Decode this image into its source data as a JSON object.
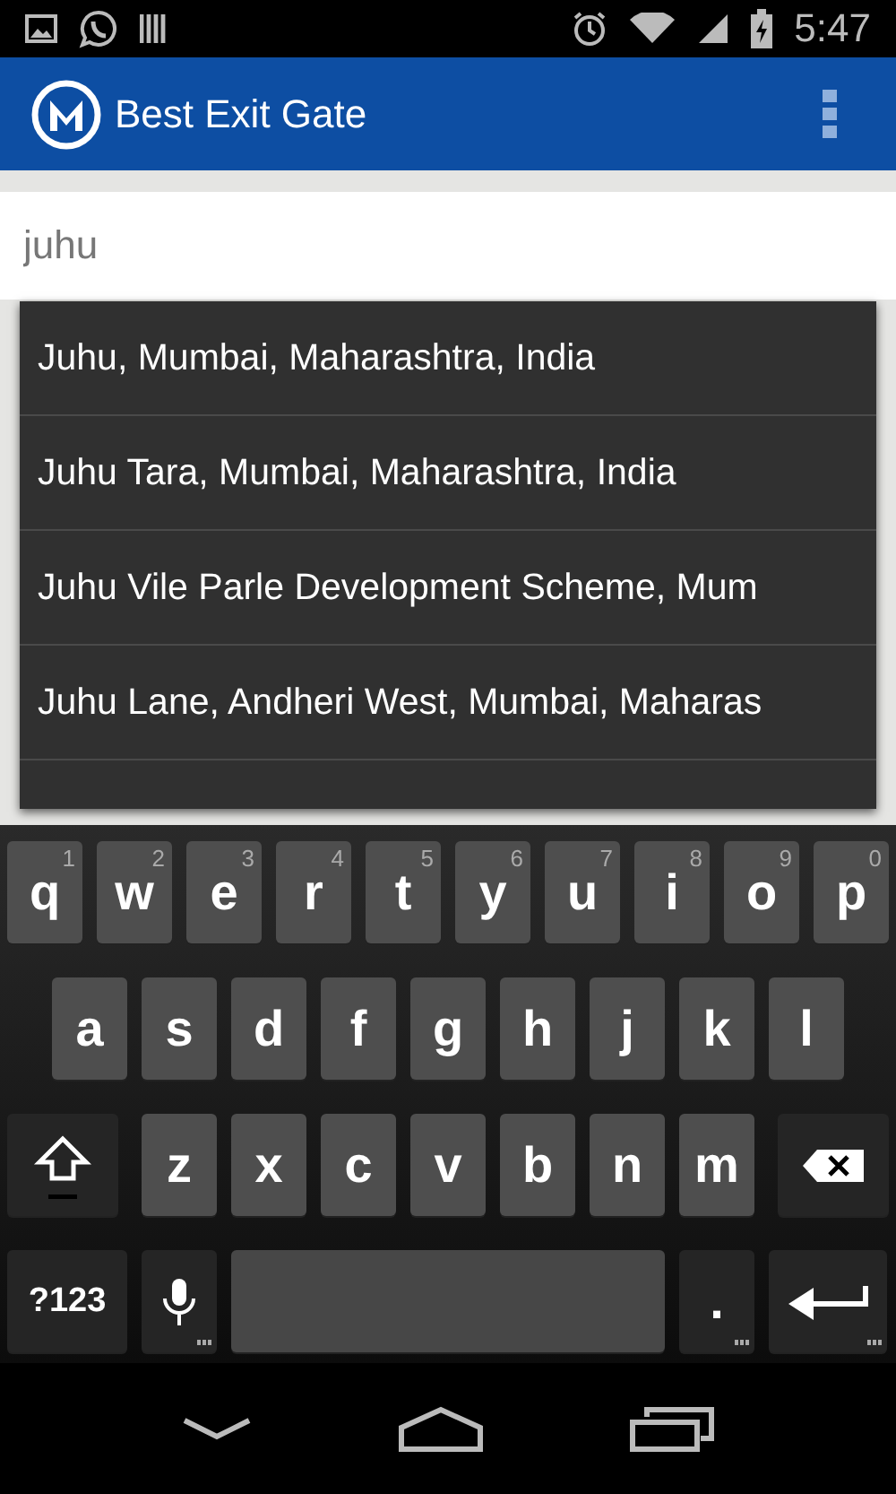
{
  "status_bar": {
    "time": "5:47"
  },
  "app_bar": {
    "title": "Best Exit Gate"
  },
  "search": {
    "value": "juhu"
  },
  "suggestions": [
    {
      "text": "Juhu, Mumbai, Maharashtra, India"
    },
    {
      "text": "Juhu Tara, Mumbai, Maharashtra, India"
    },
    {
      "text": "Juhu Vile Parle Development Scheme, Mum"
    },
    {
      "text": "Juhu Lane, Andheri West, Mumbai, Maharas"
    }
  ],
  "keyboard": {
    "rows": [
      {
        "keys": [
          {
            "kind": "letter",
            "label": "q",
            "hint": "1"
          },
          {
            "kind": "letter",
            "label": "w",
            "hint": "2"
          },
          {
            "kind": "letter",
            "label": "e",
            "hint": "3"
          },
          {
            "kind": "letter",
            "label": "r",
            "hint": "4"
          },
          {
            "kind": "letter",
            "label": "t",
            "hint": "5"
          },
          {
            "kind": "letter",
            "label": "y",
            "hint": "6"
          },
          {
            "kind": "letter",
            "label": "u",
            "hint": "7"
          },
          {
            "kind": "letter",
            "label": "i",
            "hint": "8"
          },
          {
            "kind": "letter",
            "label": "o",
            "hint": "9"
          },
          {
            "kind": "letter",
            "label": "p",
            "hint": "0"
          }
        ]
      },
      {
        "keys": [
          {
            "kind": "letter",
            "label": "a"
          },
          {
            "kind": "letter",
            "label": "s"
          },
          {
            "kind": "letter",
            "label": "d"
          },
          {
            "kind": "letter",
            "label": "f"
          },
          {
            "kind": "letter",
            "label": "g"
          },
          {
            "kind": "letter",
            "label": "h"
          },
          {
            "kind": "letter",
            "label": "j"
          },
          {
            "kind": "letter",
            "label": "k"
          },
          {
            "kind": "letter",
            "label": "l"
          }
        ]
      },
      {
        "keys": [
          {
            "kind": "shift"
          },
          {
            "kind": "letter",
            "label": "z"
          },
          {
            "kind": "letter",
            "label": "x"
          },
          {
            "kind": "letter",
            "label": "c"
          },
          {
            "kind": "letter",
            "label": "v"
          },
          {
            "kind": "letter",
            "label": "b"
          },
          {
            "kind": "letter",
            "label": "n"
          },
          {
            "kind": "letter",
            "label": "m"
          },
          {
            "kind": "delete"
          }
        ]
      },
      {
        "keys": [
          {
            "kind": "symbols",
            "label": "?123"
          },
          {
            "kind": "mic"
          },
          {
            "kind": "space"
          },
          {
            "kind": "period",
            "label": "."
          },
          {
            "kind": "enter"
          }
        ]
      }
    ]
  }
}
